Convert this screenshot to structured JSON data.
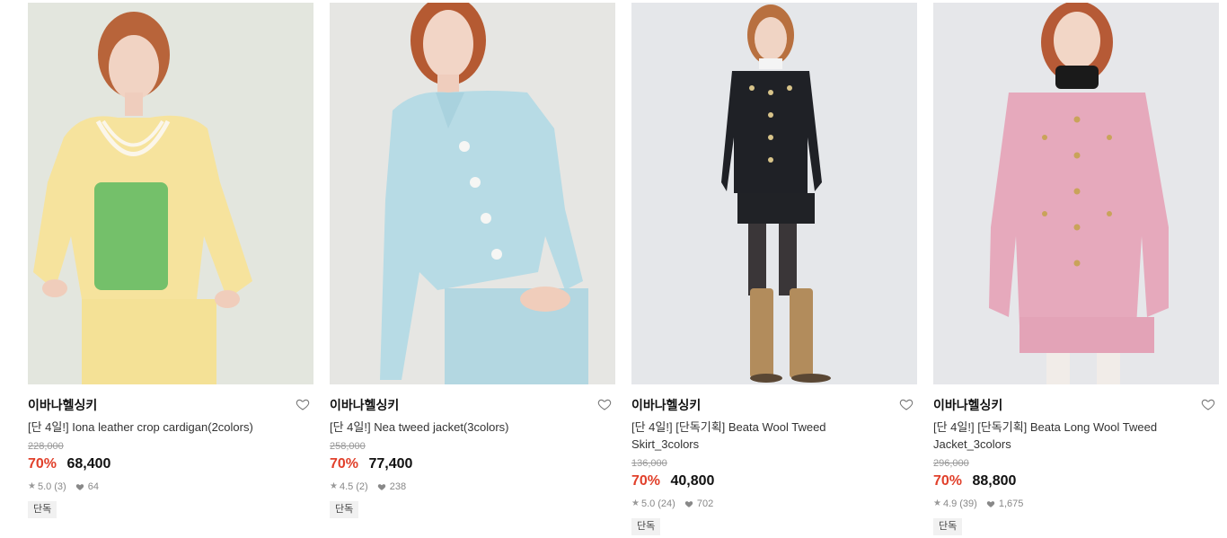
{
  "products": [
    {
      "brand": "이바나헬싱키",
      "name": "[단 4일!] Iona leather crop cardigan(2colors)",
      "original_price": "228,000",
      "discount": "70%",
      "price": "68,400",
      "rating": "5.0",
      "reviews": "(3)",
      "likes": "64",
      "tag": "단독",
      "image": "model in yellow cropped jacket with green knit top and pearl necklace",
      "colors": {
        "bg": "#e4e6df",
        "garment": "#f6e29a",
        "accent": "#7cc36a"
      }
    },
    {
      "brand": "이바나헬싱키",
      "name": "[단 4일!] Nea tweed jacket(3colors)",
      "original_price": "258,000",
      "discount": "70%",
      "price": "77,400",
      "rating": "4.5",
      "reviews": "(2)",
      "likes": "238",
      "tag": "단독",
      "image": "model in light blue tweed cropped jacket and skirt",
      "colors": {
        "bg": "#e6e6e4",
        "garment": "#b9dde6",
        "accent": "#f4f4f4"
      }
    },
    {
      "brand": "이바나헬싱키",
      "name": "[단 4일!] [단독기획] Beata Wool Tweed Skirt_3colors",
      "original_price": "136,000",
      "discount": "70%",
      "price": "40,800",
      "rating": "5.0",
      "reviews": "(24)",
      "likes": "702",
      "tag": "단독",
      "image": "model in black tweed jacket, black skirt, tan boots",
      "colors": {
        "bg": "#e5e7ea",
        "garment": "#1e1f24",
        "accent": "#b08a5a"
      }
    },
    {
      "brand": "이바나헬싱키",
      "name": "[단 4일!] [단독기획] Beata Long Wool Tweed Jacket_3colors",
      "original_price": "296,000",
      "discount": "70%",
      "price": "88,800",
      "rating": "4.9",
      "reviews": "(39)",
      "likes": "1,675",
      "tag": "단독",
      "image": "model in pink tweed long jacket and skirt with black turtleneck",
      "colors": {
        "bg": "#e6e7ea",
        "garment": "#e6aabd",
        "accent": "#1b1b1b"
      }
    }
  ],
  "icons": {
    "wishlist": "heart-outline-icon",
    "rating": "star-icon",
    "likes": "heart-filled-icon"
  }
}
